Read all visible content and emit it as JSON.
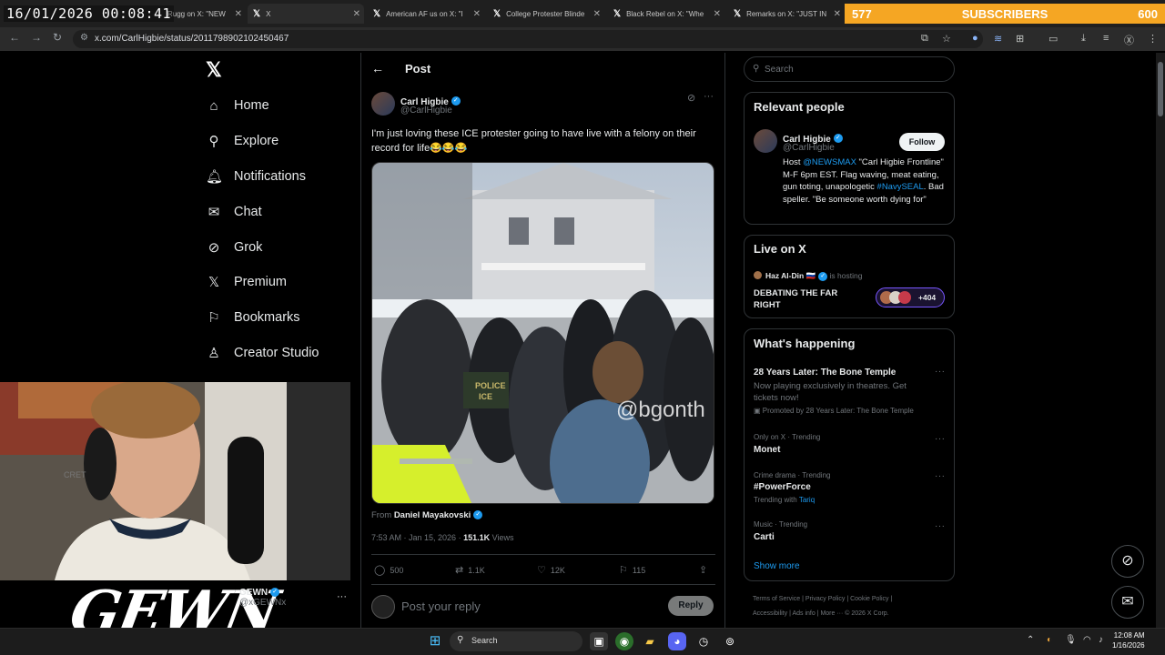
{
  "overlay": {
    "timestamp": "16/01/2026 00:08:41",
    "subs_count": "577",
    "subs_label": "SUBSCRIBERS",
    "subs_goal": "600"
  },
  "browser": {
    "tabs": [
      {
        "label": "Rugg on X: \"NEW"
      },
      {
        "label": "X"
      },
      {
        "label": "American AF us on X: \"I"
      },
      {
        "label": "College Protester Blinde"
      },
      {
        "label": "Black Rebel on X: \"Whe"
      },
      {
        "label": "Remarks on X: \"JUST IN"
      }
    ],
    "url": "x.com/CarlHigbie/status/2011798902102450467"
  },
  "nav": {
    "items": [
      {
        "label": "Home",
        "icon": "home-icon"
      },
      {
        "label": "Explore",
        "icon": "search-icon"
      },
      {
        "label": "Notifications",
        "icon": "bell-icon"
      },
      {
        "label": "Chat",
        "icon": "mail-icon"
      },
      {
        "label": "Grok",
        "icon": "grok-icon"
      },
      {
        "label": "Premium",
        "icon": "x-icon"
      },
      {
        "label": "Bookmarks",
        "icon": "bookmark-icon"
      },
      {
        "label": "Creator Studio",
        "icon": "creator-icon"
      }
    ]
  },
  "post": {
    "header": "Post",
    "author_name": "Carl Higbie",
    "author_handle": "@CarlHigbie",
    "text": "I'm just loving these ICE protester going to have live with a felony on their record for life😂😂😂",
    "video_watermark": "@bgonth",
    "from_prefix": "From",
    "from_name": "Daniel Mayakovski",
    "time": "7:53 AM · Jan 15, 2026 · ",
    "views_count": "151.1K",
    "views_label": "Views",
    "replies": "500",
    "reposts": "1.1K",
    "likes": "12K",
    "bookmarks": "115",
    "reply_placeholder": "Post your reply",
    "reply_button": "Reply"
  },
  "sidebar": {
    "search_placeholder": "Search",
    "relevant_title": "Relevant people",
    "person_name": "Carl Higbie",
    "person_handle": "@CarlHigbie",
    "follow_label": "Follow",
    "bio_1": "Host ",
    "bio_link1": "@NEWSMAX",
    "bio_2": " \"Carl Higbie Frontline\" M-F 6pm EST. Flag waving, meat eating, gun toting, unapologetic ",
    "bio_link2": "#NavySEAL",
    "bio_3": ". Bad speller. \"Be someone worth dying for\"",
    "live_title": "Live on X",
    "live_host": "Haz Al-Din 🇷🇺",
    "live_hosting": "is hosting",
    "live_topic": "DEBATING THE FAR RIGHT",
    "live_count": "+404",
    "happening_title": "What's happening",
    "trends": [
      {
        "meta": "",
        "title": "28 Years Later: The Bone Temple",
        "sub": "Now playing exclusively in theatres. Get tickets now!",
        "promo": "Promoted by 28 Years Later: The Bone Temple"
      },
      {
        "meta": "Only on X · Trending",
        "title": "Monet"
      },
      {
        "meta": "Crime drama · Trending",
        "title": "#PowerForce",
        "with_label": "Trending with ",
        "with_link": "Tariq"
      },
      {
        "meta": "Music · Trending",
        "title": "Carti"
      }
    ],
    "show_more": "Show more",
    "footer_1": "Terms of Service  |  Privacy Policy  |  Cookie Policy  |",
    "footer_2": "Accessibility  |  Ads info  |  More ···  © 2026 X Corp."
  },
  "stream": {
    "logo_text": "GEWN",
    "account_name": "GEWN",
    "account_handle": "@xGEWNx"
  },
  "taskbar": {
    "search_label": "Search",
    "time": "12:08 AM",
    "date": "1/16/2026"
  },
  "colors": {
    "accent": "#1d9bf0",
    "subs_bar": "#f5a623",
    "background": "#000000"
  }
}
